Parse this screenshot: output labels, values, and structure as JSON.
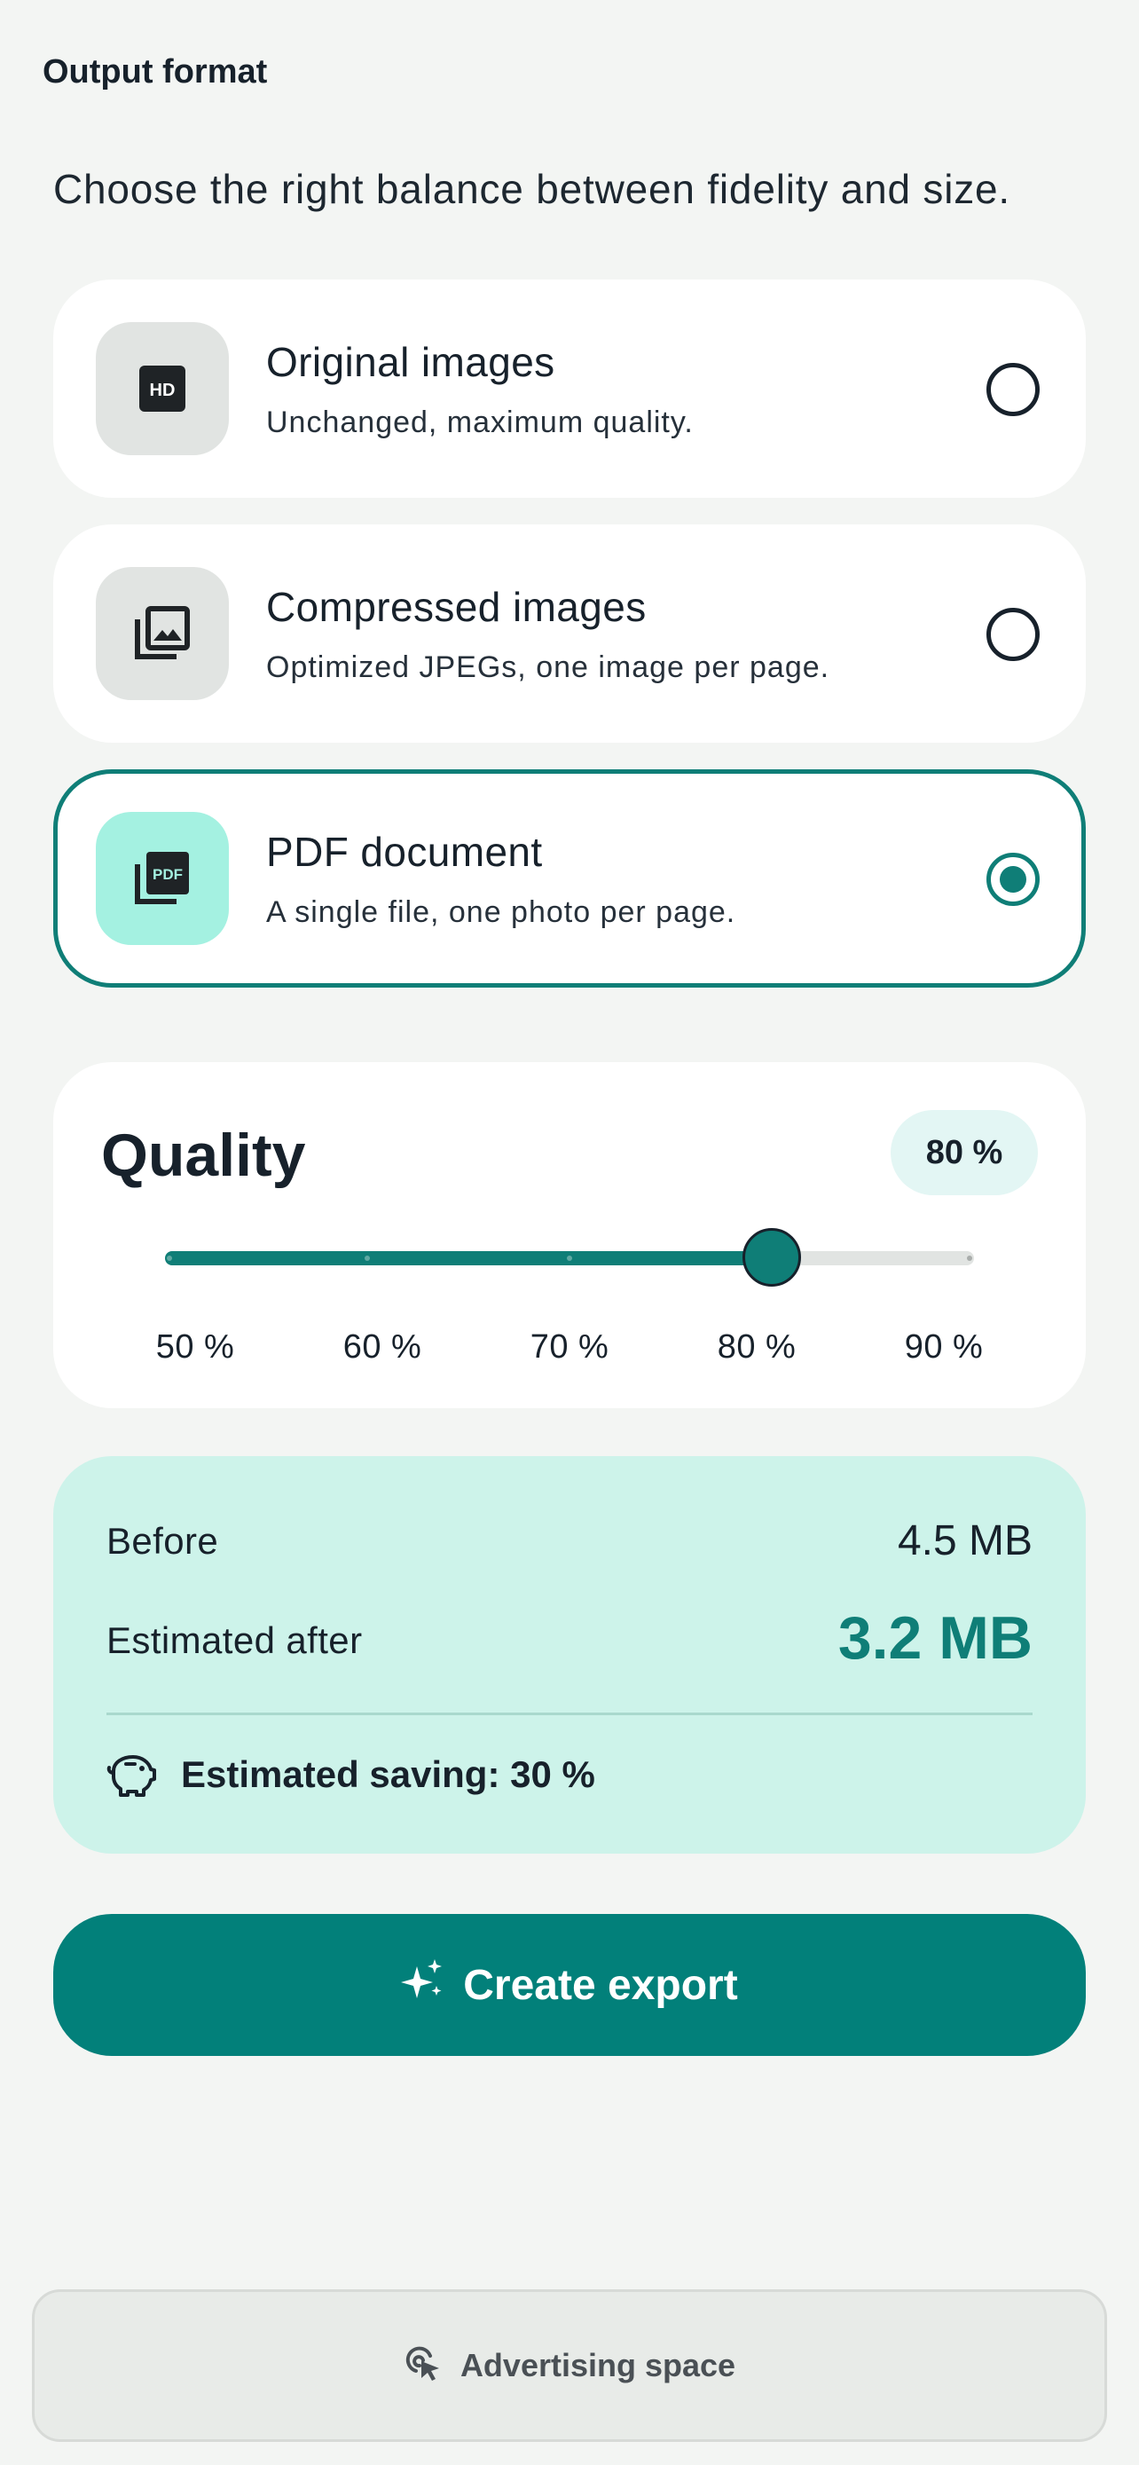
{
  "header": {
    "title": "Output format",
    "subtitle": "Choose the right balance between fidelity and size."
  },
  "options": [
    {
      "title": "Original images",
      "description": "Unchanged, maximum quality.",
      "icon": "hd-icon",
      "selected": false
    },
    {
      "title": "Compressed images",
      "description": "Optimized JPEGs, one image per page.",
      "icon": "photo-library-icon",
      "selected": false
    },
    {
      "title": "PDF document",
      "description": "A single file, one photo per page.",
      "icon": "pdf-icon",
      "selected": true
    }
  ],
  "quality": {
    "title": "Quality",
    "badge": "80 %",
    "value": 80,
    "min": 50,
    "max": 90,
    "tick_labels": [
      "50 %",
      "60 %",
      "70 %",
      "80 %",
      "90 %"
    ]
  },
  "summary": {
    "before_label": "Before",
    "before_value": "4.5 MB",
    "after_label": "Estimated after",
    "after_value": "3.2 MB",
    "saving_text": "Estimated saving: 30 %"
  },
  "actions": {
    "create_label": "Create export"
  },
  "ad": {
    "label": "Advertising space"
  },
  "colors": {
    "accent": "#0f7e77",
    "button": "#02807a",
    "summary_bg": "#cdf3ea",
    "selected_icon_bg": "#a4f1e1",
    "background": "#f3f5f3"
  }
}
